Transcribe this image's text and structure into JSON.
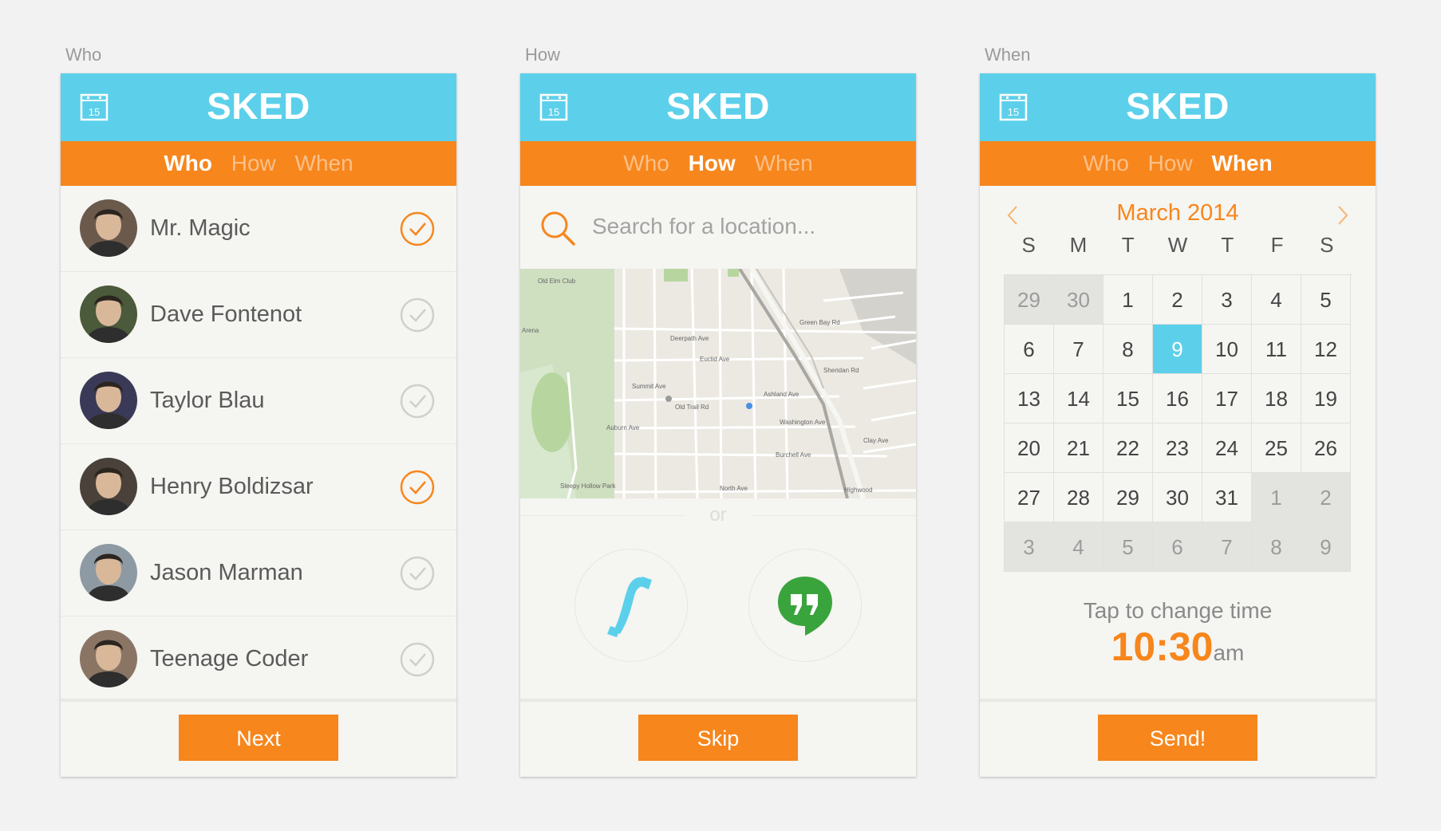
{
  "app": {
    "brand": "SKED",
    "calendar_icon_day": "15"
  },
  "tabs": [
    "Who",
    "How",
    "When"
  ],
  "screens": [
    {
      "label": "Who",
      "active_tab": 0
    },
    {
      "label": "How",
      "active_tab": 1
    },
    {
      "label": "When",
      "active_tab": 2
    }
  ],
  "who": {
    "people": [
      {
        "name": "Mr. Magic",
        "selected": true,
        "avatar": "#6b5a4c"
      },
      {
        "name": "Dave Fontenot",
        "selected": false,
        "avatar": "#4b5a3a"
      },
      {
        "name": "Taylor Blau",
        "selected": false,
        "avatar": "#3a3a58"
      },
      {
        "name": "Henry Boldizsar",
        "selected": true,
        "avatar": "#4a423a"
      },
      {
        "name": "Jason Marman",
        "selected": false,
        "avatar": "#8e9aa3"
      },
      {
        "name": "Teenage Coder",
        "selected": false,
        "avatar": "#8a7564"
      }
    ],
    "next_label": "Next"
  },
  "how": {
    "search_placeholder": "Search for a location...",
    "or_label": "or",
    "skip_label": "Skip",
    "options": [
      "phone-icon",
      "hangouts-icon"
    ],
    "map_labels": [
      "Old Elm Club",
      "Arena",
      "Deerpath Ave",
      "Euclid Ave",
      "Ashland Ave",
      "Washington Ave",
      "Auburn Ave",
      "Burchell Ave",
      "Old Trail Rd",
      "Sheridan Rd",
      "Highwood",
      "North Ave",
      "Sleepy Hollow Park",
      "Clay Ave",
      "Green Bay Rd",
      "Summit Ave"
    ]
  },
  "when": {
    "month": "March 2014",
    "weekdays": [
      "S",
      "M",
      "T",
      "W",
      "T",
      "F",
      "S"
    ],
    "days": [
      {
        "d": "29",
        "t": "other"
      },
      {
        "d": "30",
        "t": "other"
      },
      {
        "d": "1"
      },
      {
        "d": "2"
      },
      {
        "d": "3"
      },
      {
        "d": "4"
      },
      {
        "d": "5"
      },
      {
        "d": "6"
      },
      {
        "d": "7"
      },
      {
        "d": "8"
      },
      {
        "d": "9",
        "t": "today"
      },
      {
        "d": "10"
      },
      {
        "d": "11"
      },
      {
        "d": "12"
      },
      {
        "d": "13"
      },
      {
        "d": "14"
      },
      {
        "d": "15"
      },
      {
        "d": "16"
      },
      {
        "d": "17"
      },
      {
        "d": "18"
      },
      {
        "d": "19"
      },
      {
        "d": "20"
      },
      {
        "d": "21"
      },
      {
        "d": "22"
      },
      {
        "d": "23"
      },
      {
        "d": "24"
      },
      {
        "d": "25"
      },
      {
        "d": "26"
      },
      {
        "d": "27"
      },
      {
        "d": "28"
      },
      {
        "d": "29"
      },
      {
        "d": "30"
      },
      {
        "d": "31"
      },
      {
        "d": "1",
        "t": "other"
      },
      {
        "d": "2",
        "t": "other"
      },
      {
        "d": "3",
        "t": "other"
      },
      {
        "d": "4",
        "t": "other"
      },
      {
        "d": "5",
        "t": "other"
      },
      {
        "d": "6",
        "t": "other"
      },
      {
        "d": "7",
        "t": "other"
      },
      {
        "d": "8",
        "t": "other"
      },
      {
        "d": "9",
        "t": "other"
      }
    ],
    "time_label": "Tap to change time",
    "time": "10:30",
    "ampm": "am",
    "send_label": "Send!"
  },
  "colors": {
    "accent": "#f7861c",
    "brand_blue": "#5cd0ea"
  }
}
